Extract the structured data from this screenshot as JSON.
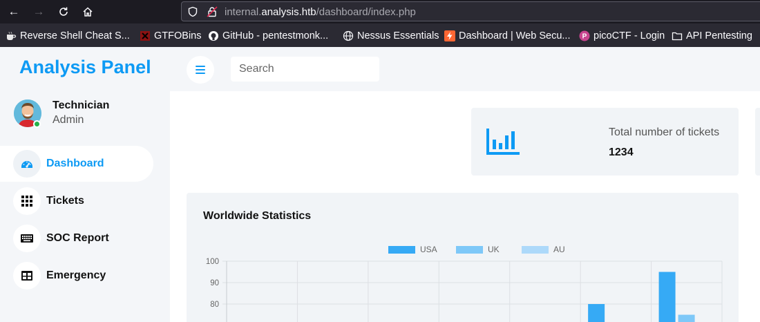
{
  "browser": {
    "url_prefix": "internal.",
    "url_domain": "analysis.htb",
    "url_path": "/dashboard/index.php",
    "bookmarks": [
      {
        "label": "Reverse Shell Cheat S...",
        "icon": "coffee-cup-icon"
      },
      {
        "label": "GTFOBins",
        "icon": "gtfobins-icon"
      },
      {
        "label": "GitHub - pentestmonk...",
        "icon": "github-icon"
      },
      {
        "label": "Nessus Essentials",
        "icon": "globe-icon"
      },
      {
        "label": "Dashboard | Web Secu...",
        "icon": "lightning-icon"
      },
      {
        "label": "picoCTF - Login",
        "icon": "picoctf-icon"
      },
      {
        "label": "API Pentesting",
        "icon": "folder-icon"
      }
    ]
  },
  "brand": "Analysis Panel",
  "user": {
    "name": "Technician",
    "role": "Admin"
  },
  "menu": [
    {
      "label": "Dashboard",
      "icon": "speedometer-icon",
      "active": true
    },
    {
      "label": "Tickets",
      "icon": "grid-icon",
      "active": false
    },
    {
      "label": "SOC Report",
      "icon": "keyboard-icon",
      "active": false
    },
    {
      "label": "Emergency",
      "icon": "table-icon",
      "active": false
    }
  ],
  "search": {
    "placeholder": "Search"
  },
  "card": {
    "title": "Total number of tickets",
    "value": "1234"
  },
  "colors": {
    "accent": "#0d9af4",
    "usa": "#36aaf5",
    "uk": "#7ec8f8",
    "au": "#add9fa"
  },
  "chart_data": {
    "type": "bar",
    "title": "Worldwide Statistics",
    "categories": [
      "",
      "",
      "",
      "",
      "",
      "",
      ""
    ],
    "series": [
      {
        "name": "USA",
        "values": [
          null,
          null,
          null,
          null,
          null,
          80,
          95
        ]
      },
      {
        "name": "UK",
        "values": [
          null,
          null,
          null,
          null,
          null,
          null,
          75
        ]
      },
      {
        "name": "AU",
        "values": [
          null,
          null,
          null,
          null,
          null,
          null,
          null
        ]
      }
    ],
    "yticks": [
      80,
      90,
      100
    ],
    "ylim_visible": [
      72,
      100
    ],
    "legend": "top",
    "grid": true
  }
}
